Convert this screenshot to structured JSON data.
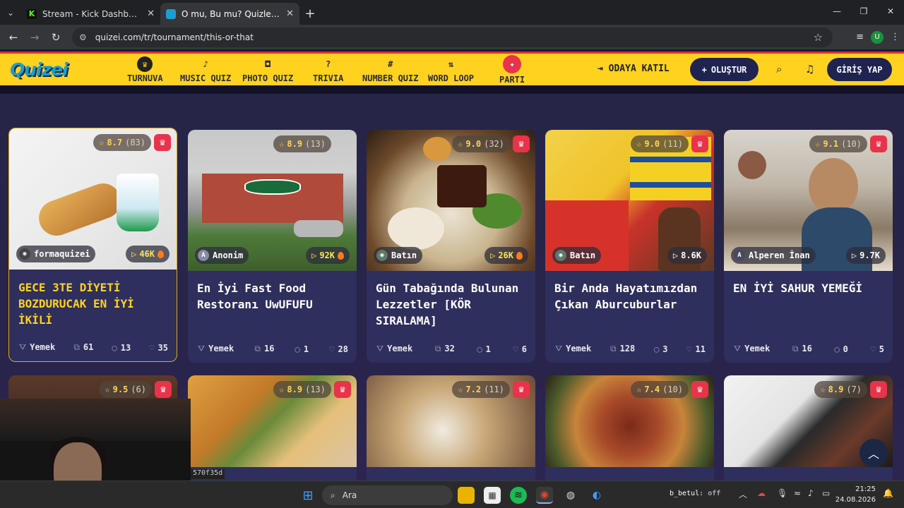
{
  "browser": {
    "tabs": [
      {
        "title": "Stream - Kick Dashboard",
        "favicon_color": "#53fc18"
      },
      {
        "title": "O mu, Bu mu? Quizleri | Turnuv",
        "favicon_color": "#1a9ed4"
      }
    ],
    "url": "quizei.com/tr/tournament/this-or-that",
    "profile_initial": "U"
  },
  "header": {
    "logo": "Quizei",
    "nav": [
      {
        "label": "TURNUVA",
        "icon": "trophy-icon"
      },
      {
        "label": "MUSIC QUIZ",
        "icon": "music-icon"
      },
      {
        "label": "PHOTO QUIZ",
        "icon": "camera-icon"
      },
      {
        "label": "TRIVIA",
        "icon": "question-icon"
      },
      {
        "label": "NUMBER QUIZ",
        "icon": "hash-icon"
      },
      {
        "label": "WORD LOOP",
        "icon": "sort-icon"
      },
      {
        "label": "PARTI",
        "icon": "party-icon"
      }
    ],
    "join_label": "ODAYA KATIL",
    "create_label": "OLUŞTUR",
    "login_label": "GİRİŞ YAP"
  },
  "cards": [
    {
      "rating": "8.7",
      "rating_count": "(83)",
      "author": "formaquizei",
      "plays": "46K",
      "hot": true,
      "title": "GECE 3TE DİYETİ BOZDURUCAK EN İYİ İKİLİ",
      "category": "Yemek",
      "items": "61",
      "comments": "13",
      "likes": "35"
    },
    {
      "rating": "8.9",
      "rating_count": "(13)",
      "author": "Anonim",
      "author_initial": "A",
      "plays": "92K",
      "hot": true,
      "title": "En İyi Fast Food Restoranı UwUFUFU",
      "category": "Yemek",
      "items": "16",
      "comments": "1",
      "likes": "28"
    },
    {
      "rating": "9.0",
      "rating_count": "(32)",
      "author": "Batın",
      "plays": "26K",
      "hot": true,
      "title": "Gün Tabağında Bulunan Lezzetler [KÖR SIRALAMA]",
      "category": "Yemek",
      "items": "32",
      "comments": "1",
      "likes": "6"
    },
    {
      "rating": "9.0",
      "rating_count": "(11)",
      "author": "Batın",
      "plays": "8.6K",
      "hot": false,
      "title": "Bir Anda Hayatımızdan Çıkan Aburcuburlar",
      "category": "Yemek",
      "items": "128",
      "comments": "3",
      "likes": "11"
    },
    {
      "rating": "9.1",
      "rating_count": "(10)",
      "author": "Alperen İnan",
      "author_initial": "A",
      "plays": "9.7K",
      "hot": false,
      "title": "EN İYİ SAHUR YEMEĞİ",
      "category": "Yemek",
      "items": "16",
      "comments": "0",
      "likes": "5"
    }
  ],
  "cards_row2": [
    {
      "rating": "9.5",
      "rating_count": "(6)"
    },
    {
      "rating": "8.9",
      "rating_count": "(13)"
    },
    {
      "rating": "7.2",
      "rating_count": "(11)"
    },
    {
      "rating": "7.4",
      "rating_count": "(10)"
    },
    {
      "rating": "8.9",
      "rating_count": "(7)"
    }
  ],
  "stream_overlay": {
    "hash_label": "570f35d",
    "user": "b_betul",
    "status": ": off"
  },
  "taskbar": {
    "search_placeholder": "Ara",
    "time": "21:25",
    "date": "24.08.2026"
  }
}
